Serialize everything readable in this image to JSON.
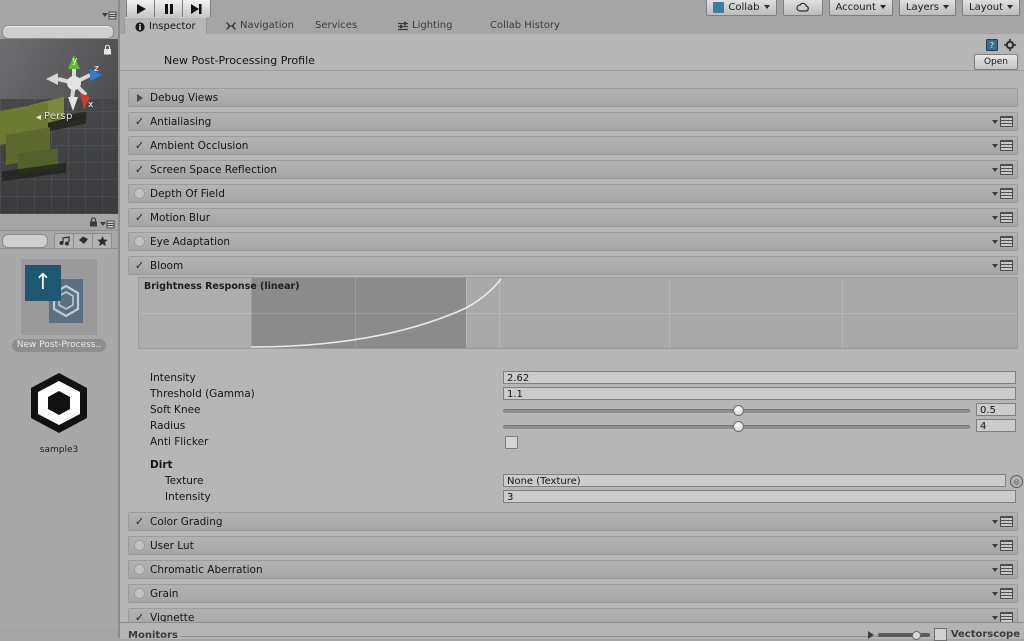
{
  "toolbar": {
    "play_label": "play-icon",
    "pause_label": "pause-icon",
    "step_label": "step-icon",
    "collab_label": "Collab",
    "cloud_label": "cloud-icon",
    "account_label": "Account",
    "layers_label": "Layers",
    "layout_label": "Layout"
  },
  "tabs": [
    {
      "label": "Inspector",
      "icon": "info-icon",
      "active": true
    },
    {
      "label": "Navigation",
      "icon": "navigation-icon",
      "active": false
    },
    {
      "label": "Services",
      "icon": "",
      "active": false
    },
    {
      "label": "Lighting",
      "icon": "lighting-icon",
      "active": false
    },
    {
      "label": "Collab History",
      "icon": "",
      "active": false
    }
  ],
  "asset_header": {
    "title": "New Post-Processing Profile",
    "help_icon": "help-book-icon",
    "settings_icon": "gear-icon",
    "open_label": "Open"
  },
  "effects": [
    {
      "label": "Debug Views",
      "state": "foldout"
    },
    {
      "label": "Antialiasing",
      "state": "checked"
    },
    {
      "label": "Ambient Occlusion",
      "state": "checked"
    },
    {
      "label": "Screen Space Reflection",
      "state": "checked"
    },
    {
      "label": "Depth Of Field",
      "state": "unchecked"
    },
    {
      "label": "Motion Blur",
      "state": "checked"
    },
    {
      "label": "Eye Adaptation",
      "state": "unchecked"
    },
    {
      "label": "Bloom",
      "state": "checked"
    }
  ],
  "effects_after_bloom": [
    {
      "label": "Color Grading",
      "state": "checked"
    },
    {
      "label": "User Lut",
      "state": "unchecked"
    },
    {
      "label": "Chromatic Aberration",
      "state": "unchecked"
    },
    {
      "label": "Grain",
      "state": "unchecked"
    },
    {
      "label": "Vignette",
      "state": "checked"
    }
  ],
  "bloom": {
    "graph_label": "Brightness Response (linear)",
    "fields": [
      {
        "label": "Intensity",
        "type": "number",
        "value": "2.62"
      },
      {
        "label": "Threshold (Gamma)",
        "type": "number",
        "value": "1.1"
      },
      {
        "label": "Soft Knee",
        "type": "slider",
        "value": "0.5",
        "fill": 0.5
      },
      {
        "label": "Radius",
        "type": "slider",
        "value": "4",
        "fill": 0.5
      },
      {
        "label": "Anti Flicker",
        "type": "checkbox",
        "value": ""
      }
    ],
    "dirt_title": "Dirt",
    "dirt_fields": [
      {
        "label": "Texture",
        "type": "object",
        "value": "None (Texture)"
      },
      {
        "label": "Intensity",
        "type": "number",
        "value": "3"
      }
    ]
  },
  "scene_view": {
    "persp_label": "Persp",
    "axis_y": "y",
    "axis_z": "z",
    "axis_x": "x",
    "lock_icon": "lock-icon",
    "menu_icon": "panel-menu-icon"
  },
  "project": {
    "lock_icon": "lock-icon",
    "menu_icon": "panel-menu-icon",
    "buttons": [
      "favorite-filter-icon",
      "label-filter-icon",
      "star-filter-icon"
    ],
    "assets": [
      {
        "label": "New Post-Process..",
        "icon": "post-processing-profile-icon",
        "selected": true
      },
      {
        "label": "sample3",
        "icon": "unity-scene-icon",
        "selected": false
      }
    ]
  },
  "bottom": {
    "monitors_label": "Monitors",
    "vectorscope_label": "Vectorscope"
  },
  "colors": {
    "panel_bg": "#b6b6b6",
    "window_bg": "#a5a5a5",
    "row_bg": "#b3b3b3",
    "field_bg": "#cccccc",
    "accent_blue": "#1f5670"
  }
}
